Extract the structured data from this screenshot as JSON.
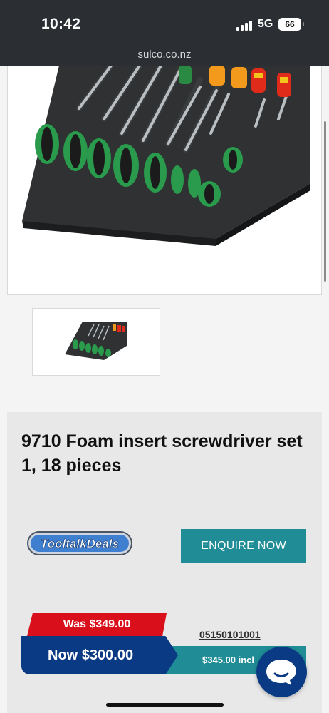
{
  "status_bar": {
    "time": "10:42",
    "network": "5G",
    "battery": "66"
  },
  "browser": {
    "url": "sulco.co.nz"
  },
  "product": {
    "title": "9710 Foam insert screwdriver set 1, 18 pieces",
    "main_image_alt": "9710 Foam insert screwdriver set 1, 18 pieces",
    "thumbnail_alt": "9710 Foam insert screwdriver set 1, 18 pieces thumbnail"
  },
  "deals_logo": {
    "text": "TooltalkDeals"
  },
  "enquire_button": {
    "label": "ENQUIRE NOW"
  },
  "pricing": {
    "was": "Was $349.00",
    "now": "Now $300.00",
    "incl": "$345.00 incl",
    "sku": "05150101001"
  },
  "colors": {
    "accent_teal": "#1f8c96",
    "price_blue": "#0b3a84",
    "was_red": "#d9101b"
  }
}
